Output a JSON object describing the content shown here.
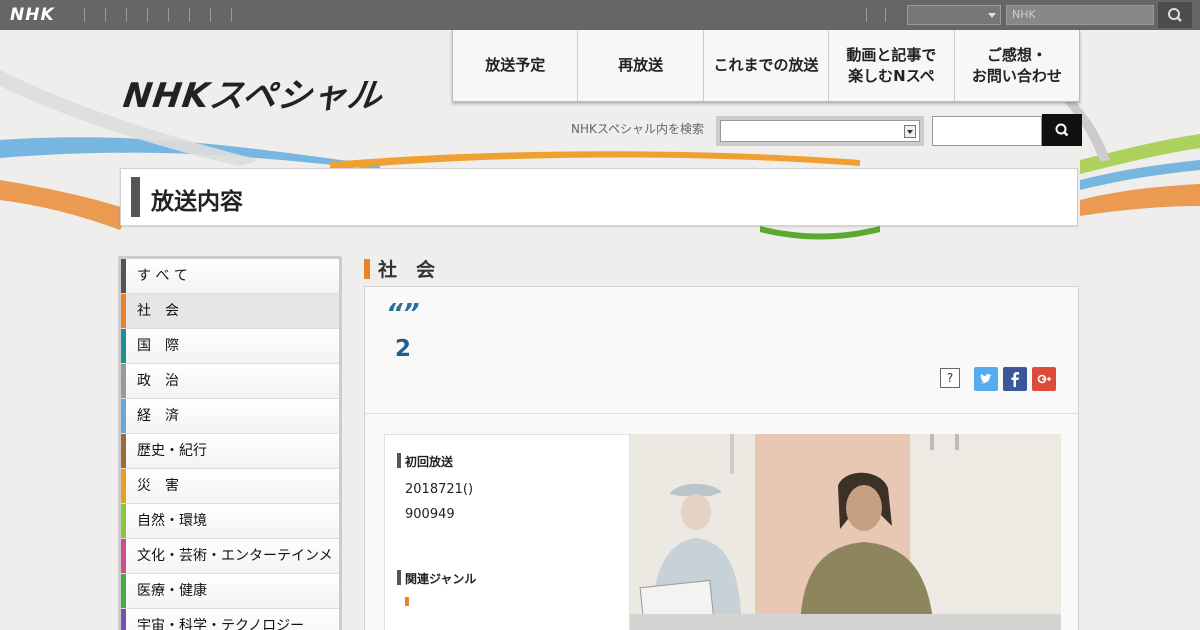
{
  "topbar": {
    "logo": "NHK",
    "search_placeholder": "NHK"
  },
  "header": {
    "brand": "NHKスペシャル",
    "nav": [
      {
        "id": "schedule",
        "label": "放送予定"
      },
      {
        "id": "rerun",
        "label": "再放送"
      },
      {
        "id": "past",
        "label": "これまでの放送"
      },
      {
        "id": "video",
        "label": "動画と記事で\n楽しむNスペ"
      },
      {
        "id": "contact",
        "label": "ご感想・\nお問い合わせ"
      }
    ],
    "site_search_label": "NHKスペシャル内を検索"
  },
  "page": {
    "title": "放送内容"
  },
  "sidebar": {
    "categories": [
      {
        "label": "す べ て",
        "color": "#555555",
        "active": false
      },
      {
        "label": "社　会",
        "color": "#e8852a",
        "active": true
      },
      {
        "label": "国　際",
        "color": "#1f8f8f",
        "active": false
      },
      {
        "label": "政　治",
        "color": "#999999",
        "active": false
      },
      {
        "label": "経　済",
        "color": "#6aa7d6",
        "active": false
      },
      {
        "label": "歴史・紀行",
        "color": "#9a6a3a",
        "active": false
      },
      {
        "label": "災　害",
        "color": "#e8a020",
        "active": false
      },
      {
        "label": "自然・環境",
        "color": "#8cc63f",
        "active": false
      },
      {
        "label": "文化・芸術・エンターテインメント",
        "color": "#d04d8f",
        "active": false
      },
      {
        "label": "医療・健康",
        "color": "#4aa84a",
        "active": false
      },
      {
        "label": "宇宙・科学・テクノロジー",
        "color": "#7a4fb0",
        "active": false
      }
    ]
  },
  "content": {
    "section_title": "社　会",
    "quote": "“”",
    "episode_number": "2",
    "help_label": "?",
    "first_broadcast_label": "初回放送",
    "first_broadcast_date": "2018721()",
    "first_broadcast_time": "900949",
    "related_genre_label": "関連ジャンル"
  }
}
